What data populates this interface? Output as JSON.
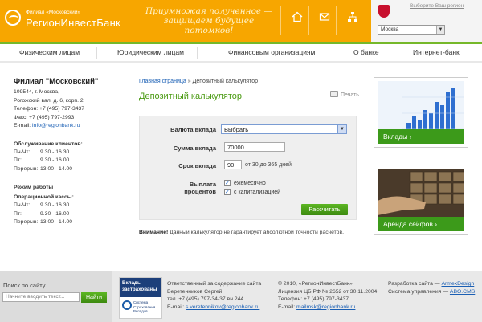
{
  "header": {
    "logo_sub": "Филиал «Московский»",
    "logo_name": "РегионИнвестБанк",
    "slogan": "Приумножая полученное — защищаем будущее потомков!",
    "region_link": "Выберите Ваш регион",
    "region_selected": "Москва",
    "icons": [
      "home-icon",
      "mail-icon",
      "sitemap-icon"
    ]
  },
  "nav": {
    "items": [
      {
        "label": "Физическим лицам"
      },
      {
        "label": "Юридическим лицам"
      },
      {
        "label": "Финансовым организациям"
      },
      {
        "label": "О банке"
      },
      {
        "label": "Интернет-банк"
      }
    ]
  },
  "sidebar": {
    "title": "Филиал \"Московский\"",
    "address_1": "109544, г. Москва,",
    "address_2": "Рогожский вал, д. 6, корп. 2",
    "phone": "Телефон: +7 (495) 797-3437",
    "fax": "Факс: +7 (495) 797-2993",
    "email_label": "E-mail:",
    "email": "info@regionbank.ru",
    "service_title": "Обслуживание клиентов:",
    "service_hours": [
      {
        "day": "Пн-Чт:",
        "time": "9.30 - 16.30"
      },
      {
        "day": "Пт:",
        "time": "9.30 - 16.00"
      },
      {
        "day": "Перерыв:",
        "time": "13.00 - 14.00"
      }
    ],
    "work_title": "Режим работы",
    "cash_title": "Операционной кассы:",
    "cash_hours": [
      {
        "day": "Пн-Чт:",
        "time": "9.30 - 16.30"
      },
      {
        "day": "Пт:",
        "time": "9.30 - 16.00"
      },
      {
        "day": "Перерыв:",
        "time": "13.00 - 14.00"
      }
    ]
  },
  "main": {
    "breadcrumb_home": "Главная страница",
    "breadcrumb_sep": "»",
    "breadcrumb_current": "Депозитный калькулятор",
    "title": "Депозитный калькулятор",
    "print": "Печать",
    "form": {
      "currency_label": "Валюта вклада",
      "currency_value": "Выбрать",
      "amount_label": "Сумма вклада",
      "amount_value": "70000",
      "term_label": "Срок вклада",
      "term_value": "90",
      "term_hint": "от 30 до 365 дней",
      "payout_label_1": "Выплата",
      "payout_label_2": "процентов",
      "opt_monthly": "ежемесячно",
      "opt_capital": "с капитализацией",
      "submit": "Рассчитать"
    },
    "notice_bold": "Внимание!",
    "notice_text": " Данный калькулятор не гарантирует абсолютной точности расчетов."
  },
  "banners": {
    "deposits": "Вклады ›",
    "safes": "Аренда сейфов ›"
  },
  "footer": {
    "search_label": "Поиск по сайту",
    "search_placeholder": "Начните вводить текст...",
    "search_button": "Найти",
    "insured_title": "Вклады застрахованы",
    "insured_org": "Система Страхования Вкладов",
    "resp_1": "Ответственный за содержание сайта",
    "resp_2": "Веретенников Сергей",
    "resp_3": "тел. +7 (495) 797-34-37 вн.244",
    "resp_email_label": "E-mail:",
    "resp_email": "s.veretennikov@regionbank.ru",
    "copy_1": "© 2010, «РегионИнвестБанк»",
    "copy_2": "Лицензия ЦБ РФ № 2652 от 30.11.2004",
    "copy_3": "Телефон: +7 (495) 797-3437",
    "copy_email_label": "E-mail:",
    "copy_email": "mailmsk@regionbank.ru",
    "dev_1_label": "Разработка сайта —",
    "dev_1_link": "ArmexDesign",
    "dev_2_label": "Система управления —",
    "dev_2_link": "ABO.CMS"
  }
}
